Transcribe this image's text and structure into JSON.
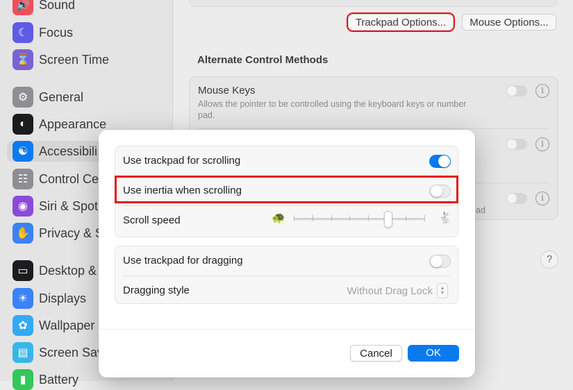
{
  "sidebar": {
    "items": [
      {
        "label": "Sound",
        "icon": "speaker-icon",
        "color": "#ef4f5a"
      },
      {
        "label": "Focus",
        "icon": "moon-icon",
        "color": "#5e5ce6"
      },
      {
        "label": "Screen Time",
        "icon": "hourglass-icon",
        "color": "#7b61d6"
      },
      {
        "label": "General",
        "icon": "gear-icon",
        "color": "#8e8e93"
      },
      {
        "label": "Appearance",
        "icon": "appearance-icon",
        "color": "#1c1c1e"
      },
      {
        "label": "Accessibili",
        "icon": "accessibility-icon",
        "color": "#0a7af0"
      },
      {
        "label": "Control Cer",
        "icon": "control-center-icon",
        "color": "#8e8e93"
      },
      {
        "label": "Siri & Spotl",
        "icon": "siri-icon",
        "color": "#8a4bd6"
      },
      {
        "label": "Privacy & S",
        "icon": "hand-icon",
        "color": "#3b82f6"
      },
      {
        "label": "Desktop &",
        "icon": "desktop-icon",
        "color": "#1c1c1e"
      },
      {
        "label": "Displays",
        "icon": "sun-icon",
        "color": "#3b82f6"
      },
      {
        "label": "Wallpaper",
        "icon": "flower-icon",
        "color": "#33aaf5"
      },
      {
        "label": "Screen Sav",
        "icon": "screensaver-icon",
        "color": "#38b6e8"
      },
      {
        "label": "Battery",
        "icon": "battery-icon",
        "color": "#34c759"
      }
    ]
  },
  "main": {
    "trackpad_options_label": "Trackpad Options...",
    "mouse_options_label": "Mouse Options...",
    "section_title": "Alternate Control Methods",
    "mouse_keys_title": "Mouse Keys",
    "mouse_keys_desc": "Allows the pointer to be controlled using the keyboard keys or number pad.",
    "peek_text": "ad",
    "help_label": "?"
  },
  "dialog": {
    "rows": {
      "scrolling": {
        "label": "Use trackpad for scrolling",
        "on": true
      },
      "inertia": {
        "label": "Use inertia when scrolling",
        "on": false
      },
      "scroll_speed": {
        "label": "Scroll speed",
        "value_fraction": 0.72
      },
      "dragging": {
        "label": "Use trackpad for dragging",
        "on": false
      },
      "dragging_style": {
        "label": "Dragging style",
        "value": "Without Drag Lock"
      }
    },
    "cancel_label": "Cancel",
    "ok_label": "OK"
  },
  "colors": {
    "accent": "#0a7af0",
    "highlight": "#e1131a"
  }
}
